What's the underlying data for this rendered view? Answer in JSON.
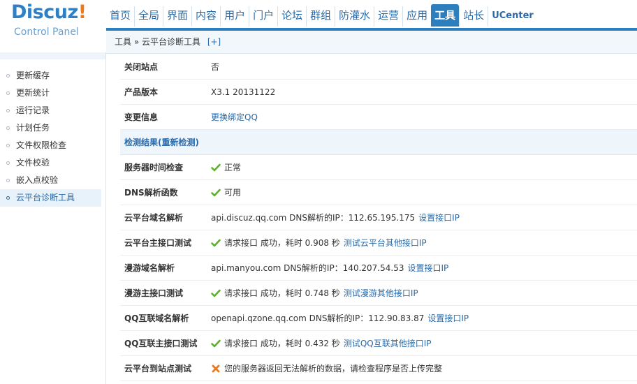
{
  "logo": {
    "brand": "Discuz",
    "bang": "!",
    "sub": "Control Panel"
  },
  "nav": {
    "items": [
      "首页",
      "全局",
      "界面",
      "内容",
      "用户",
      "门户",
      "论坛",
      "群组",
      "防灌水",
      "运营",
      "应用",
      "工具",
      "站长",
      "UCenter"
    ],
    "active": "工具"
  },
  "breadcrumb": {
    "path": "工具 » 云平台诊断工具",
    "expand": "[+]"
  },
  "sidebar": {
    "items": [
      {
        "label": "更新缓存"
      },
      {
        "label": "更新统计"
      },
      {
        "label": "运行记录"
      },
      {
        "label": "计划任务"
      },
      {
        "label": "文件权限检查"
      },
      {
        "label": "文件校验"
      },
      {
        "label": "嵌入点校验"
      },
      {
        "label": "云平台诊断工具"
      }
    ],
    "active_index": 7
  },
  "info": {
    "close_site": {
      "label": "关闭站点",
      "value": "否"
    },
    "version": {
      "label": "产品版本",
      "value": "X3.1 20131122"
    },
    "change": {
      "label": "变更信息",
      "link": "更换绑定QQ"
    }
  },
  "results": {
    "title": "检测结果(重新检测)",
    "server_time": {
      "label": "服务器时间检查",
      "value": "正常"
    },
    "dns_func": {
      "label": "DNS解析函数",
      "value": "可用"
    },
    "cloud_dns": {
      "label": "云平台域名解析",
      "value": "api.discuz.qq.com DNS解析的IP：112.65.195.175",
      "link": "设置接口IP"
    },
    "cloud_api": {
      "label": "云平台主接口测试",
      "value": "请求接口 成功，耗时 0.908 秒",
      "link": "测试云平台其他接口IP"
    },
    "manyou_dns": {
      "label": "漫游域名解析",
      "value": "api.manyou.com DNS解析的IP：140.207.54.53",
      "link": "设置接口IP"
    },
    "manyou_api": {
      "label": "漫游主接口测试",
      "value": "请求接口 成功，耗时 0.748 秒",
      "link": "测试漫游其他接口IP"
    },
    "qq_dns": {
      "label": "QQ互联域名解析",
      "value": "openapi.qzone.qq.com DNS解析的IP：112.90.83.87",
      "link": "设置接口IP"
    },
    "qq_api": {
      "label": "QQ互联主接口测试",
      "value": "请求接口 成功，耗时 0.432 秒",
      "link": "测试QQ互联其他接口IP"
    },
    "cloud_site": {
      "label": "云平台到站点测试",
      "value": "您的服务器返回无法解析的数据，请检查程序是否上传完整"
    }
  },
  "colors": {
    "accent": "#2d7ebc",
    "link": "#2a6aa8",
    "ok": "#5cb02c",
    "error": "#e8791d"
  }
}
